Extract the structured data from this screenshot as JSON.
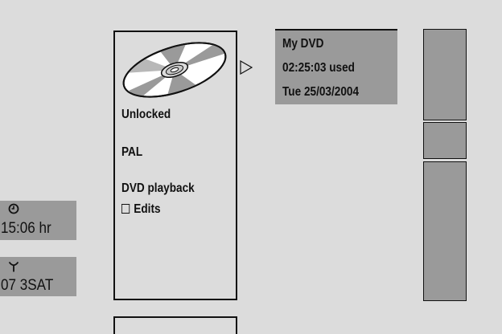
{
  "disc_panel": {
    "lock_status": "Unlocked",
    "video_system": "PAL",
    "mode": "DVD playback",
    "edits_label": "Edits",
    "edits_checked": false
  },
  "info_box": {
    "title": "My DVD",
    "used": "02:25:03 used",
    "date": "Tue 25/03/2004"
  },
  "status": {
    "clock_icon": "clock-icon",
    "time": "15:06 hr",
    "antenna_icon": "antenna-icon",
    "channel": "07 3SAT"
  },
  "colors": {
    "background": "#dcdcdc",
    "panel_gray": "#9a9a9a",
    "line": "#111111"
  }
}
